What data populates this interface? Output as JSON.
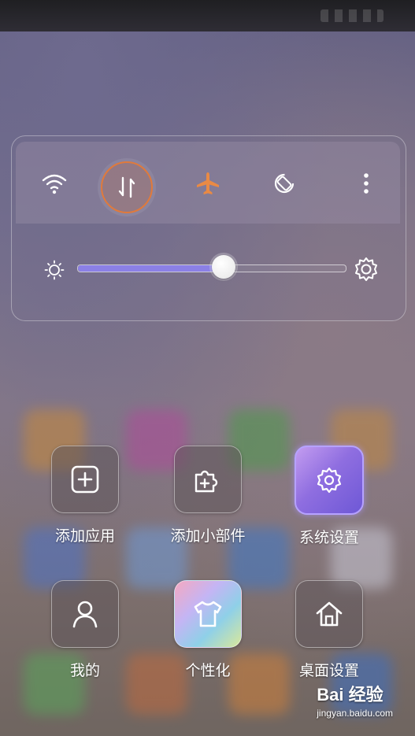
{
  "quick_toggles": {
    "wifi_icon": "wifi-icon",
    "mobile_data_icon": "mobile-data-icon",
    "airplane_icon": "airplane-icon",
    "rotation_lock_icon": "rotation-lock-icon",
    "more_icon": "more-icon",
    "active_color": "#e07a3c"
  },
  "brightness": {
    "level_fraction": 0.55,
    "fill_color": "#8b80e6"
  },
  "apps": [
    {
      "label": "添加应用",
      "icon": "add-app-icon"
    },
    {
      "label": "添加小部件",
      "icon": "add-widget-icon"
    },
    {
      "label": "系统设置",
      "icon": "settings-gear-icon"
    },
    {
      "label": "我的",
      "icon": "profile-icon"
    },
    {
      "label": "个性化",
      "icon": "tshirt-icon"
    },
    {
      "label": "桌面设置",
      "icon": "home-icon"
    }
  ],
  "watermark": {
    "main": "Bai 经验",
    "sub": "jingyan.baidu.com"
  }
}
